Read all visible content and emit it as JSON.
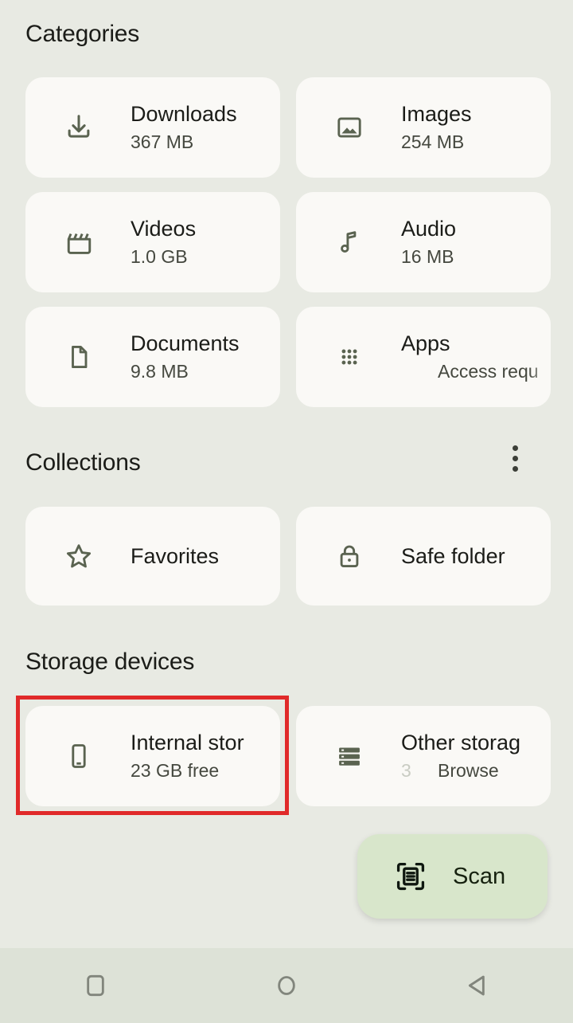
{
  "sections": {
    "categories": {
      "title": "Categories"
    },
    "collections": {
      "title": "Collections",
      "menu_icon": "overflow-menu-icon"
    },
    "storage_devices": {
      "title": "Storage devices"
    }
  },
  "categories": [
    {
      "label": "Downloads",
      "size": "367 MB",
      "icon": "download-icon"
    },
    {
      "label": "Images",
      "size": "254 MB",
      "icon": "image-icon"
    },
    {
      "label": "Videos",
      "size": "1.0 GB",
      "icon": "video-icon"
    },
    {
      "label": "Audio",
      "size": "16 MB",
      "icon": "audio-icon"
    },
    {
      "label": "Documents",
      "size": "9.8 MB",
      "icon": "document-icon"
    },
    {
      "label": "Apps",
      "size": "Access requ",
      "icon": "apps-grid-icon"
    }
  ],
  "collections": [
    {
      "label": "Favorites",
      "icon": "star-icon"
    },
    {
      "label": "Safe folder",
      "icon": "lock-icon"
    }
  ],
  "storage_devices": [
    {
      "label": "Internal stor",
      "size": "23 GB free",
      "icon": "phone-icon",
      "ghost": ""
    },
    {
      "label": "Other storag",
      "size": "Browse ",
      "icon": "storage-icon",
      "ghost": "3"
    }
  ],
  "fab": {
    "label": "Scan",
    "icon": "document-scan-icon"
  },
  "navbar": {
    "recents": "recents-square-icon",
    "home": "home-circle-icon",
    "back": "back-triangle-icon"
  },
  "highlight": {
    "color": "#E02A2A",
    "target": "internal-storage-card"
  }
}
